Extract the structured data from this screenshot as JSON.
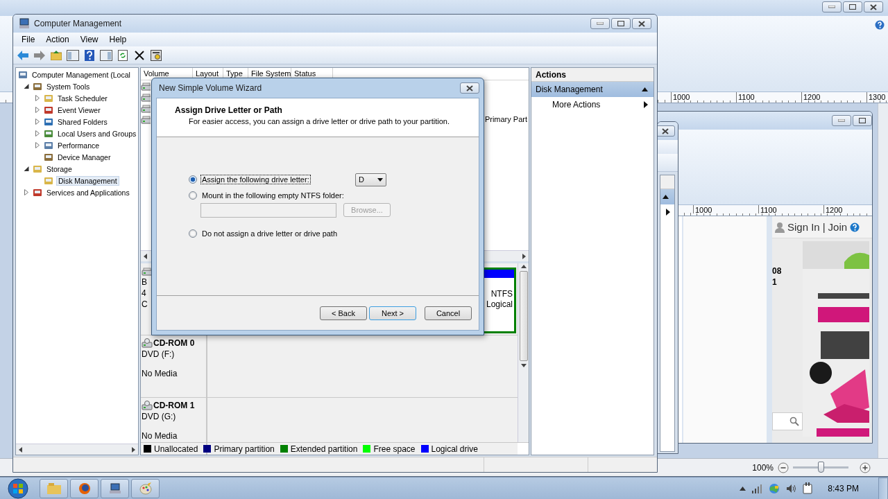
{
  "paint_window": {
    "ruler_marks": [
      "1000",
      "1100",
      "1200",
      "1300"
    ],
    "zoom": {
      "reading": "100%",
      "level": 0.5
    }
  },
  "paint_window_2": {
    "ruler_marks": [
      "1000",
      "1100",
      "1200"
    ],
    "web_page": {
      "sign_in": "Sign In",
      "separator": "|",
      "join": "Join",
      "numbers": [
        "08",
        "1"
      ],
      "ad": {
        "kind": "picture"
      }
    }
  },
  "main_window": {
    "title": "Computer Management",
    "menu": [
      "File",
      "Action",
      "View",
      "Help"
    ],
    "tree": [
      {
        "label": "Computer Management (Local",
        "selected": false,
        "children": [
          {
            "label": "System Tools",
            "expanded": true,
            "selected": false,
            "children": [
              {
                "label": "Task Scheduler",
                "expanded": false,
                "selected": false
              },
              {
                "label": "Event Viewer",
                "expanded": false,
                "selected": false
              },
              {
                "label": "Shared Folders",
                "expanded": false,
                "selected": false
              },
              {
                "label": "Local Users and Groups",
                "expanded": false,
                "selected": false
              },
              {
                "label": "Performance",
                "expanded": false,
                "selected": false
              },
              {
                "label": "Device Manager",
                "selected": false
              }
            ]
          },
          {
            "label": "Storage",
            "expanded": true,
            "selected": false,
            "children": [
              {
                "label": "Disk Management",
                "selected": true
              }
            ]
          },
          {
            "label": "Services and Applications",
            "expanded": false,
            "selected": false
          }
        ]
      }
    ],
    "volume_list": {
      "columns": [
        "Volume",
        "Layout",
        "Type",
        "File System",
        "Status"
      ],
      "rows": [
        {
          "kind": "volume"
        },
        {
          "kind": "volume"
        },
        {
          "kind": "volume"
        },
        {
          "kind": "volume",
          "column_6": "Primary Part"
        }
      ]
    },
    "disks": [
      {
        "kind": "disk",
        "lines": [
          "B",
          "4",
          "C"
        ],
        "partition": {
          "lines": [
            "NTFS",
            "Logical"
          ]
        }
      },
      {
        "kind": "cdrom",
        "name": "CD-ROM 0",
        "lines": [
          "DVD (F:)",
          "No Media"
        ]
      },
      {
        "kind": "cdrom",
        "name": "CD-ROM 1",
        "lines": [
          "DVD (G:)",
          "No Media"
        ]
      }
    ],
    "legend": [
      {
        "label": "Unallocated",
        "color": "#000000"
      },
      {
        "label": "Primary partition",
        "color": "#000080"
      },
      {
        "label": "Extended partition",
        "color": "#008000"
      },
      {
        "label": "Free space",
        "color": "#00ff00"
      },
      {
        "label": "Logical drive",
        "color": "#0000ff"
      }
    ],
    "actions": {
      "title": "Actions",
      "sections": [
        {
          "label": "Disk Management",
          "expanded": true,
          "items": [
            "More Actions"
          ]
        }
      ]
    }
  },
  "wizard": {
    "title": "New Simple Volume Wizard",
    "heading": "Assign Drive Letter or Path",
    "subheading": "For easier access, you can assign a drive letter or drive path to your partition.",
    "options": [
      {
        "label": "Assign the following drive letter:",
        "selected": true,
        "focused": true
      },
      {
        "label": "Mount in the following empty NTFS folder:",
        "selected": false,
        "focused": false
      },
      {
        "label": "Do not assign a drive letter or drive path",
        "selected": false,
        "focused": false
      }
    ],
    "drive_letter": "D",
    "folder_field": {
      "disabled": true
    },
    "browse": {
      "label": "Browse...",
      "disabled": true
    },
    "buttons": [
      {
        "label": "< Back",
        "default": false
      },
      {
        "label": "Next >",
        "default": true
      },
      {
        "label": "Cancel",
        "default": false
      }
    ]
  },
  "taskbar": {
    "clock": "8:43 PM"
  }
}
